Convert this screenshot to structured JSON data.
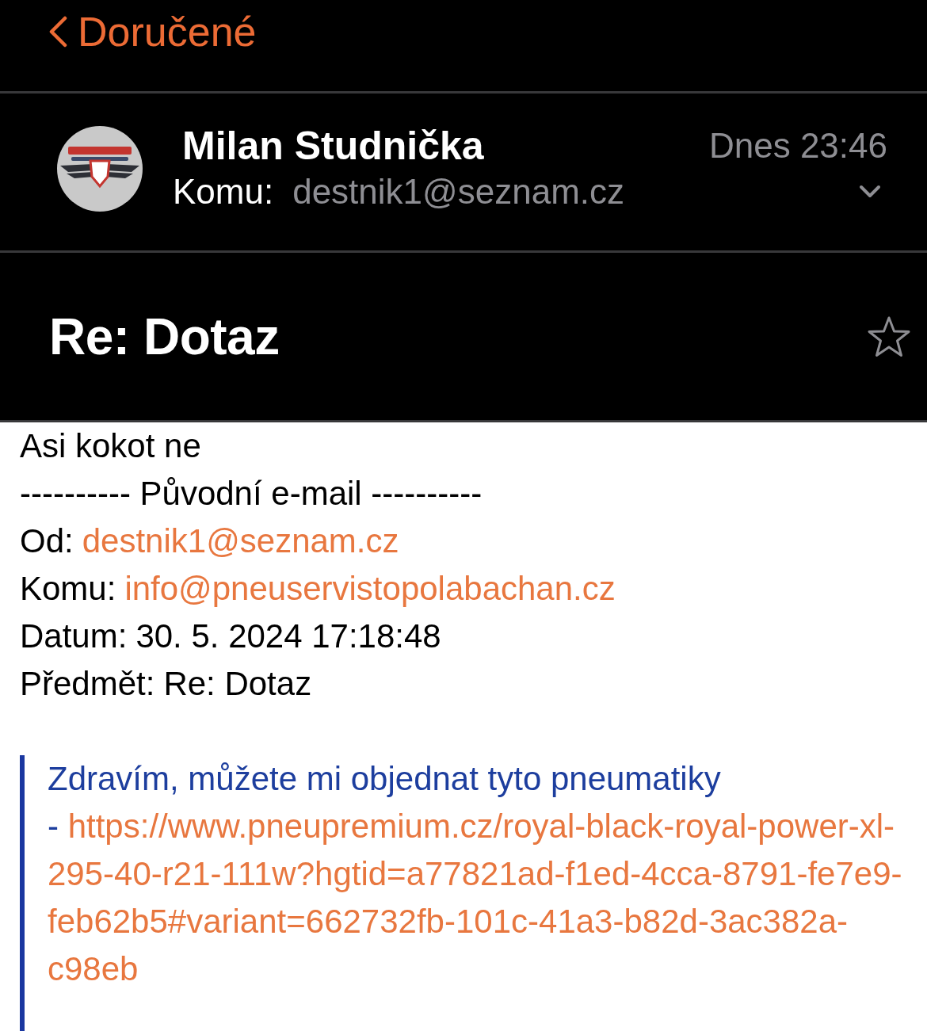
{
  "nav": {
    "back_label": "Doručené"
  },
  "header": {
    "sender": "Milan Studnička",
    "to_label": "Komu:",
    "to_address": "destnik1@seznam.cz",
    "date": "Dnes 23:46",
    "details_expanded": false
  },
  "subject": {
    "title": "Re: Dotaz",
    "flagged": false
  },
  "body": {
    "reply": "Asi kokot ne",
    "separator": "---------- Původní e-mail ----------",
    "fields": [
      {
        "label": "Od:",
        "value": "destnik1@seznam.cz",
        "kind": "link"
      },
      {
        "label": "Komu:",
        "value": "info@pneuservistopolabachan.cz",
        "kind": "link"
      },
      {
        "label": "Datum:",
        "value": "30. 5. 2024 17:18:48",
        "kind": "text"
      },
      {
        "label": "Předmět:",
        "value": "Re: Dotaz",
        "kind": "text"
      }
    ],
    "quote": {
      "greeting": "Zdravím, můžete mi objednat tyto pneumatiky",
      "dash": "-",
      "link": "https://www.pneupremium.cz/royal-black-royal-power-xl-295-40-r21-111w?hgtid=a77821ad-f1ed-4cca-8791-fe7e9-feb62b5#variant=662732fb-101c-41a3-b82d-3ac382a-c98eb"
    }
  }
}
